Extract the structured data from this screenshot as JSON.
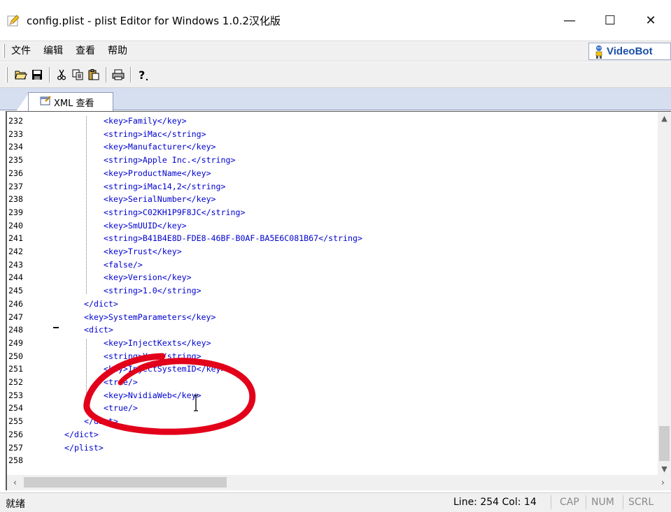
{
  "window": {
    "title": "config.plist - plist Editor for Windows 1.0.2汉化版",
    "minimize_label": "—",
    "maximize_label": "☐",
    "close_label": "✕"
  },
  "menu": {
    "items": [
      {
        "label": "文件"
      },
      {
        "label": "编辑"
      },
      {
        "label": "查看"
      },
      {
        "label": "帮助"
      }
    ],
    "brand": "VideoBot"
  },
  "tabs": [
    {
      "label": "XML 查看"
    }
  ],
  "editor": {
    "lines": [
      {
        "num": "232",
        "code": "<key>Family</key>"
      },
      {
        "num": "233",
        "code": "<string>iMac</string>"
      },
      {
        "num": "234",
        "code": "<key>Manufacturer</key>"
      },
      {
        "num": "235",
        "code": "<string>Apple Inc.</string>"
      },
      {
        "num": "236",
        "code": "<key>ProductName</key>"
      },
      {
        "num": "237",
        "code": "<string>iMac14,2</string>"
      },
      {
        "num": "238",
        "code": "<key>SerialNumber</key>"
      },
      {
        "num": "239",
        "code": "<string>C02KH1P9F8JC</string>"
      },
      {
        "num": "240",
        "code": "<key>SmUUID</key>"
      },
      {
        "num": "241",
        "code": "<string>B41B4E8D-FDE8-46BF-B0AF-BA5E6C081B67</string>"
      },
      {
        "num": "242",
        "code": "<key>Trust</key>"
      },
      {
        "num": "243",
        "code": "<false/>"
      },
      {
        "num": "244",
        "code": "<key>Version</key>"
      },
      {
        "num": "245",
        "code": "<string>1.0</string>"
      },
      {
        "num": "246",
        "code": "</dict>"
      },
      {
        "num": "247",
        "code": "<key>SystemParameters</key>"
      },
      {
        "num": "248",
        "code": "<dict>"
      },
      {
        "num": "249",
        "code": "<key>InjectKexts</key>"
      },
      {
        "num": "250",
        "code": "<string>Yes</string>"
      },
      {
        "num": "251",
        "code": "<key>InjectSystemID</key>"
      },
      {
        "num": "252",
        "code": "<true/>"
      },
      {
        "num": "253",
        "code": "<key>NvidiaWeb</key>"
      },
      {
        "num": "254",
        "code": "<true/>"
      },
      {
        "num": "255",
        "code": "</dict>"
      },
      {
        "num": "256",
        "code": "</dict>"
      },
      {
        "num": "257",
        "code": "</plist>"
      },
      {
        "num": "258",
        "code": ""
      }
    ]
  },
  "status": {
    "ready": "就绪",
    "position": "Line: 254  Col: 14",
    "cap": "CAP",
    "num": "NUM",
    "scrl": "SCRL"
  },
  "colors": {
    "xml_text": "#0000d0",
    "annotation": "#e2001a",
    "tab_strip": "#d6dff0"
  }
}
